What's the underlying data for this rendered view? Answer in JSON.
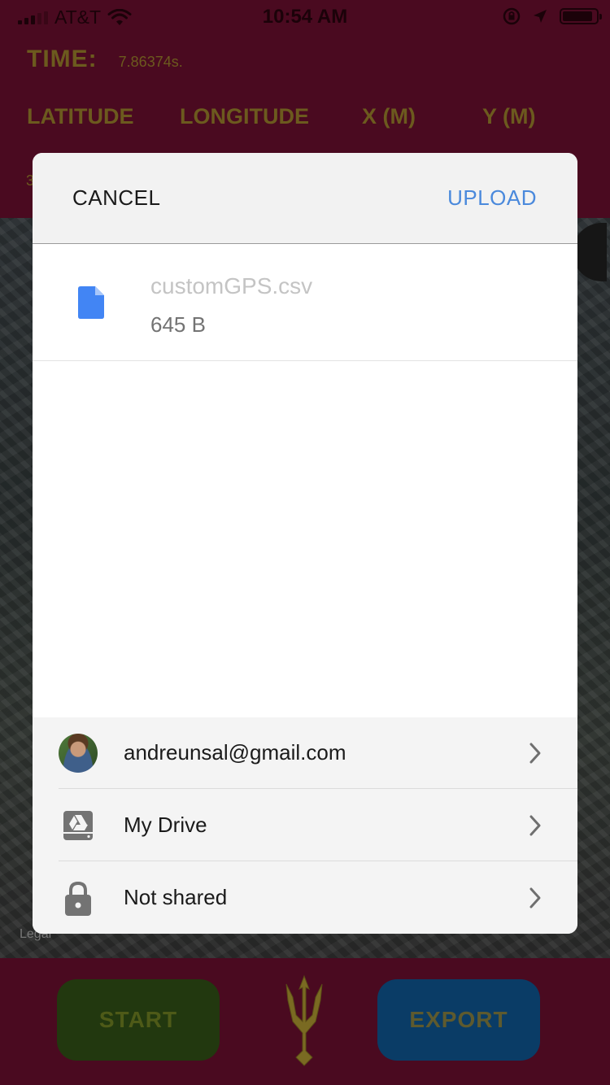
{
  "status_bar": {
    "carrier": "AT&T",
    "time": "10:54 AM"
  },
  "app": {
    "time_label": "TIME:",
    "time_value": "7.86374s.",
    "columns": [
      "LATITUDE",
      "LONGITUDE",
      "X (M)",
      "Y (M)"
    ],
    "row_fragment": "3",
    "legal": "Legal",
    "start_label": "START",
    "export_label": "EXPORT"
  },
  "sheet": {
    "cancel_label": "CANCEL",
    "upload_label": "UPLOAD",
    "file": {
      "name": "customGPS.csv",
      "size": "645 B",
      "icon": "document-icon"
    },
    "options": [
      {
        "label": "andreunsal@gmail.com",
        "icon": "avatar"
      },
      {
        "label": "My Drive",
        "icon": "google-drive-icon"
      },
      {
        "label": "Not shared",
        "icon": "lock-icon"
      }
    ]
  },
  "colors": {
    "header_bg": "#4a0a20",
    "gold_text": "#6c5a1e",
    "upload_blue": "#4a89dc",
    "file_icon_blue": "#4285f4",
    "start_bg": "#22380f",
    "export_bg": "#0a3c66"
  }
}
